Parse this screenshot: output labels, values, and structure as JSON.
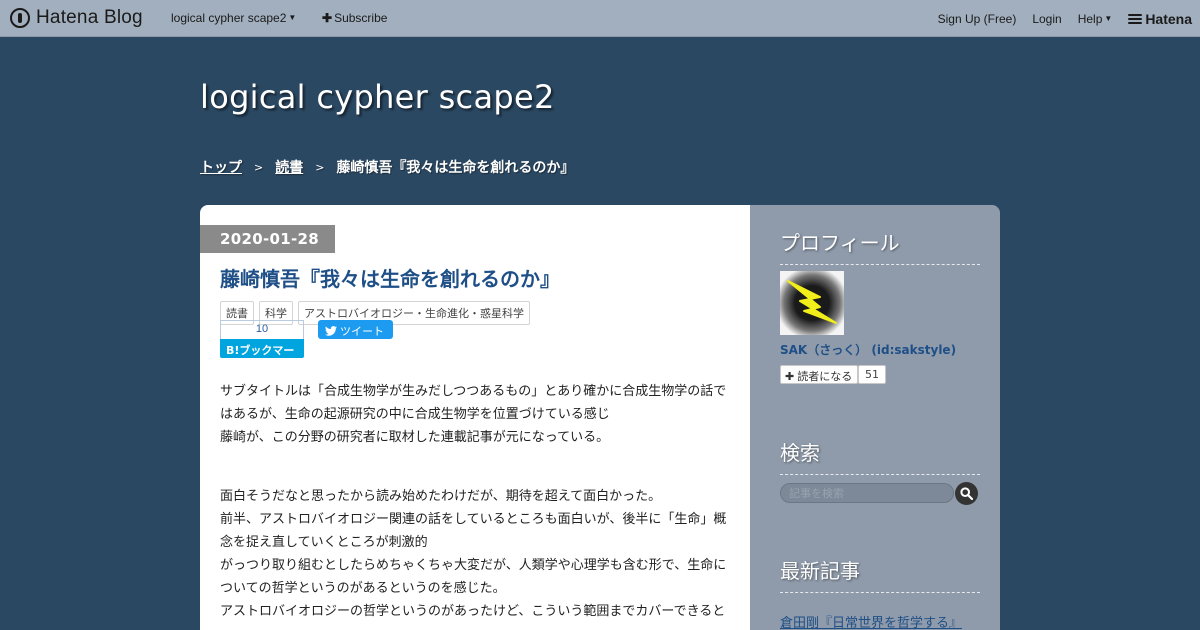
{
  "topbar": {
    "logo": "Hatena Blog",
    "blog_menu": "logical cypher scape2",
    "subscribe": "Subscribe",
    "signup": "Sign Up (Free)",
    "login": "Login",
    "help": "Help",
    "hatena": "Hatena"
  },
  "header": {
    "blog_title": "logical cypher scape2",
    "breadcrumb": [
      "トップ",
      "読書",
      "藤崎慎吾『我々は生命を創れるのか』"
    ],
    "sep": ">"
  },
  "entry": {
    "date": "2020-01-28",
    "title": "藤崎慎吾『我々は生命を創れるのか』",
    "categories": [
      "読書",
      "科学",
      "アストロバイオロジー・生命進化・惑星科学"
    ],
    "bookmark_count": "10",
    "bookmark_label": "B!ブックマーク",
    "tweet_label": "ツイート",
    "paragraphs1": [
      "サブタイトルは「合成生物学が生みだしつつあるもの」とあり確かに合成生物学の話ではあるが、生命の起源研究の中に合成生物学を位置づけている感じ",
      "藤崎が、この分野の研究者に取材した連載記事が元になっている。"
    ],
    "paragraphs2": [
      "面白そうだなと思ったから読み始めたわけだが、期待を超えて面白かった。",
      "前半、アストロバイオロジー関連の話をしているところも面白いが、後半に「生命」概念を捉え直していくところが刺激的",
      "がっつり取り組むとしたらめちゃくちゃ大変だが、人類学や心理学も含む形で、生命についての哲学というのがあるというのを感じた。",
      "アストロバイオロジーの哲学というのがあったけど、こういう範囲までカバーできると"
    ]
  },
  "sidebar": {
    "profile_heading": "プロフィール",
    "profile_name": "SAK（さっく） (id:sakstyle)",
    "reader_button": "読者になる",
    "reader_count": "51",
    "search_heading": "検索",
    "search_placeholder": "記事を検索",
    "recent_heading": "最新記事",
    "recent_item": "倉田剛『日常世界を哲学する』"
  },
  "colors": {
    "background": "#2b4862",
    "topbar": "#a2afbe",
    "link": "#1e4f86",
    "sidebar": "#8f9bab",
    "date_badge": "#8a8a8a",
    "bookmark": "#00a4de",
    "tweet": "#1d9bf0"
  }
}
